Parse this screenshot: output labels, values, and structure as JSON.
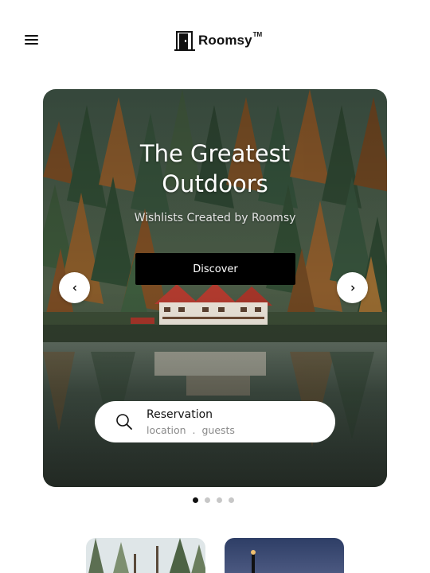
{
  "header": {
    "menu_icon": "hamburger-menu-icon",
    "brand_icon": "door-icon",
    "brand_name": "Roomsy",
    "brand_tm": "TM"
  },
  "hero": {
    "title_line1": "The Greatest",
    "title_line2": "Outdoors",
    "subtitle": "Wishlists Created by Roomsy",
    "cta_label": "Discover",
    "prev_icon": "chevron-left-icon",
    "next_icon": "chevron-right-icon",
    "search": {
      "icon": "search-icon",
      "title": "Reservation",
      "fields": "location  .  guests"
    }
  },
  "carousel": {
    "slide_count": 4,
    "active_index": 0
  },
  "colors": {
    "accent": "#000000",
    "dot_inactive": "#c7c7c7",
    "muted_text": "#8a8a8a"
  }
}
